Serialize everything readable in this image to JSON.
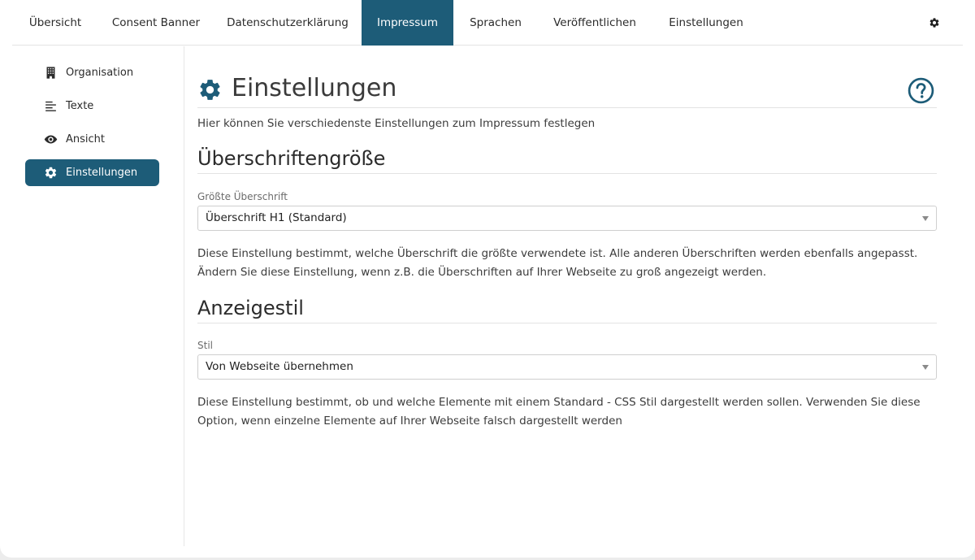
{
  "topnav": {
    "tabs": [
      {
        "label": "Übersicht"
      },
      {
        "label": "Consent Banner"
      },
      {
        "label": "Datenschutzerklärung"
      },
      {
        "label": "Impressum"
      },
      {
        "label": "Sprachen"
      },
      {
        "label": "Veröffentlichen"
      },
      {
        "label": "Einstellungen"
      }
    ],
    "active_tab": "Impressum",
    "settings_icon": "gear-icon"
  },
  "sidebar": {
    "items": [
      {
        "label": "Organisation",
        "icon": "building-icon"
      },
      {
        "label": "Texte",
        "icon": "align-left-icon"
      },
      {
        "label": "Ansicht",
        "icon": "eye-icon"
      },
      {
        "label": "Einstellungen",
        "icon": "gear-icon"
      }
    ],
    "active_item": "Einstellungen"
  },
  "main": {
    "title": "Einstellungen",
    "title_icon": "gear-icon",
    "help_icon": "question-circle-icon",
    "intro": "Hier können Sie verschiedenste Einstellungen zum Impressum festlegen",
    "sections": [
      {
        "heading": "Überschriftengröße",
        "field_label": "Größte Überschrift",
        "select_value": "Überschrift H1 (Standard)",
        "description": "Diese Einstellung bestimmt, welche Überschrift die größte verwendete ist. Alle anderen Überschriften werden ebenfalls angepasst. Ändern Sie diese Einstellung, wenn z.B. die Überschriften auf Ihrer Webseite zu groß angezeigt werden."
      },
      {
        "heading": "Anzeigestil",
        "field_label": "Stil",
        "select_value": "Von Webseite übernehmen",
        "description": "Diese Einstellung bestimmt, ob und welche Elemente mit einem Standard - CSS Stil dargestellt werden sollen. Verwenden Sie diese Option, wenn einzelne Elemente auf Ihrer Webseite falsch dargestellt werden"
      }
    ]
  },
  "colors": {
    "accent": "#1d5c78",
    "text": "#2b2b2b",
    "muted": "#6b6b6b",
    "border": "#e3e3e3"
  }
}
